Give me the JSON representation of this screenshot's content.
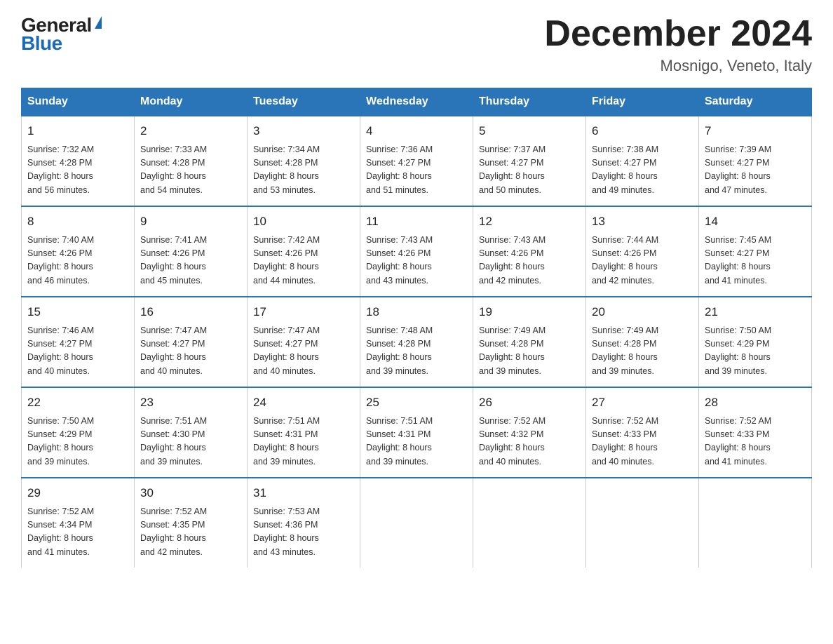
{
  "logo": {
    "general": "General",
    "blue": "Blue"
  },
  "title": "December 2024",
  "location": "Mosnigo, Veneto, Italy",
  "days_of_week": [
    "Sunday",
    "Monday",
    "Tuesday",
    "Wednesday",
    "Thursday",
    "Friday",
    "Saturday"
  ],
  "weeks": [
    [
      {
        "day": "1",
        "sunrise": "7:32 AM",
        "sunset": "4:28 PM",
        "daylight": "8 hours and 56 minutes."
      },
      {
        "day": "2",
        "sunrise": "7:33 AM",
        "sunset": "4:28 PM",
        "daylight": "8 hours and 54 minutes."
      },
      {
        "day": "3",
        "sunrise": "7:34 AM",
        "sunset": "4:28 PM",
        "daylight": "8 hours and 53 minutes."
      },
      {
        "day": "4",
        "sunrise": "7:36 AM",
        "sunset": "4:27 PM",
        "daylight": "8 hours and 51 minutes."
      },
      {
        "day": "5",
        "sunrise": "7:37 AM",
        "sunset": "4:27 PM",
        "daylight": "8 hours and 50 minutes."
      },
      {
        "day": "6",
        "sunrise": "7:38 AM",
        "sunset": "4:27 PM",
        "daylight": "8 hours and 49 minutes."
      },
      {
        "day": "7",
        "sunrise": "7:39 AM",
        "sunset": "4:27 PM",
        "daylight": "8 hours and 47 minutes."
      }
    ],
    [
      {
        "day": "8",
        "sunrise": "7:40 AM",
        "sunset": "4:26 PM",
        "daylight": "8 hours and 46 minutes."
      },
      {
        "day": "9",
        "sunrise": "7:41 AM",
        "sunset": "4:26 PM",
        "daylight": "8 hours and 45 minutes."
      },
      {
        "day": "10",
        "sunrise": "7:42 AM",
        "sunset": "4:26 PM",
        "daylight": "8 hours and 44 minutes."
      },
      {
        "day": "11",
        "sunrise": "7:43 AM",
        "sunset": "4:26 PM",
        "daylight": "8 hours and 43 minutes."
      },
      {
        "day": "12",
        "sunrise": "7:43 AM",
        "sunset": "4:26 PM",
        "daylight": "8 hours and 42 minutes."
      },
      {
        "day": "13",
        "sunrise": "7:44 AM",
        "sunset": "4:26 PM",
        "daylight": "8 hours and 42 minutes."
      },
      {
        "day": "14",
        "sunrise": "7:45 AM",
        "sunset": "4:27 PM",
        "daylight": "8 hours and 41 minutes."
      }
    ],
    [
      {
        "day": "15",
        "sunrise": "7:46 AM",
        "sunset": "4:27 PM",
        "daylight": "8 hours and 40 minutes."
      },
      {
        "day": "16",
        "sunrise": "7:47 AM",
        "sunset": "4:27 PM",
        "daylight": "8 hours and 40 minutes."
      },
      {
        "day": "17",
        "sunrise": "7:47 AM",
        "sunset": "4:27 PM",
        "daylight": "8 hours and 40 minutes."
      },
      {
        "day": "18",
        "sunrise": "7:48 AM",
        "sunset": "4:28 PM",
        "daylight": "8 hours and 39 minutes."
      },
      {
        "day": "19",
        "sunrise": "7:49 AM",
        "sunset": "4:28 PM",
        "daylight": "8 hours and 39 minutes."
      },
      {
        "day": "20",
        "sunrise": "7:49 AM",
        "sunset": "4:28 PM",
        "daylight": "8 hours and 39 minutes."
      },
      {
        "day": "21",
        "sunrise": "7:50 AM",
        "sunset": "4:29 PM",
        "daylight": "8 hours and 39 minutes."
      }
    ],
    [
      {
        "day": "22",
        "sunrise": "7:50 AM",
        "sunset": "4:29 PM",
        "daylight": "8 hours and 39 minutes."
      },
      {
        "day": "23",
        "sunrise": "7:51 AM",
        "sunset": "4:30 PM",
        "daylight": "8 hours and 39 minutes."
      },
      {
        "day": "24",
        "sunrise": "7:51 AM",
        "sunset": "4:31 PM",
        "daylight": "8 hours and 39 minutes."
      },
      {
        "day": "25",
        "sunrise": "7:51 AM",
        "sunset": "4:31 PM",
        "daylight": "8 hours and 39 minutes."
      },
      {
        "day": "26",
        "sunrise": "7:52 AM",
        "sunset": "4:32 PM",
        "daylight": "8 hours and 40 minutes."
      },
      {
        "day": "27",
        "sunrise": "7:52 AM",
        "sunset": "4:33 PM",
        "daylight": "8 hours and 40 minutes."
      },
      {
        "day": "28",
        "sunrise": "7:52 AM",
        "sunset": "4:33 PM",
        "daylight": "8 hours and 41 minutes."
      }
    ],
    [
      {
        "day": "29",
        "sunrise": "7:52 AM",
        "sunset": "4:34 PM",
        "daylight": "8 hours and 41 minutes."
      },
      {
        "day": "30",
        "sunrise": "7:52 AM",
        "sunset": "4:35 PM",
        "daylight": "8 hours and 42 minutes."
      },
      {
        "day": "31",
        "sunrise": "7:53 AM",
        "sunset": "4:36 PM",
        "daylight": "8 hours and 43 minutes."
      },
      null,
      null,
      null,
      null
    ]
  ],
  "labels": {
    "sunrise": "Sunrise: ",
    "sunset": "Sunset: ",
    "daylight": "Daylight: "
  }
}
